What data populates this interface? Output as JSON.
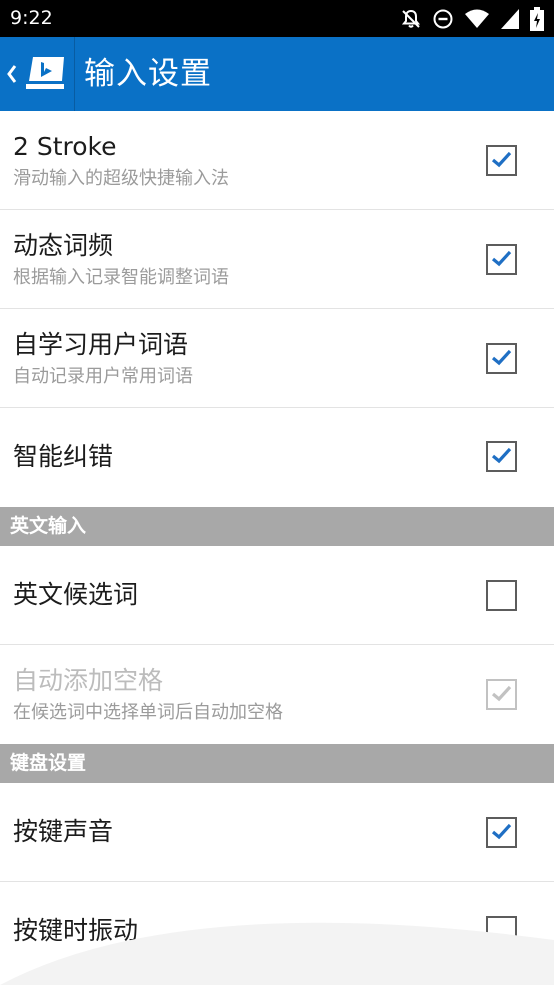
{
  "status_bar": {
    "time": "9:22",
    "icons": [
      "notifications-off-icon",
      "do-not-disturb-icon",
      "wifi-icon",
      "signal-icon",
      "battery-charging-icon"
    ]
  },
  "app_bar": {
    "title": "输入设置",
    "background_color": "#0a71c6",
    "back_icon": "chevron-left-icon",
    "logo_icon": "bing-keyboard-logo-icon"
  },
  "settings": {
    "two_stroke": {
      "title": "2 Stroke",
      "summary": "滑动输入的超级快捷输入法",
      "checked": true
    },
    "dynamic_frequency": {
      "title": "动态词频",
      "summary": "根据输入记录智能调整词语",
      "checked": true
    },
    "self_learning": {
      "title": "自学习用户词语",
      "summary": "自动记录用户常用词语",
      "checked": true
    },
    "smart_correction": {
      "title": "智能纠错",
      "checked": true
    },
    "english_section": {
      "label": "英文输入"
    },
    "english_candidates": {
      "title": "英文候选词",
      "checked": false
    },
    "auto_space": {
      "title": "自动添加空格",
      "summary": "在候选词中选择单词后自动加空格",
      "checked": true,
      "enabled": false
    },
    "keyboard_section": {
      "label": "键盘设置"
    },
    "key_sound": {
      "title": "按键声音",
      "checked": true
    },
    "key_vibration": {
      "title": "按键时振动",
      "checked": false
    }
  },
  "colors": {
    "check_mark": "#1f6fc4",
    "check_mark_disabled": "#c2c2c2",
    "section_header": "#a8a8a8"
  }
}
